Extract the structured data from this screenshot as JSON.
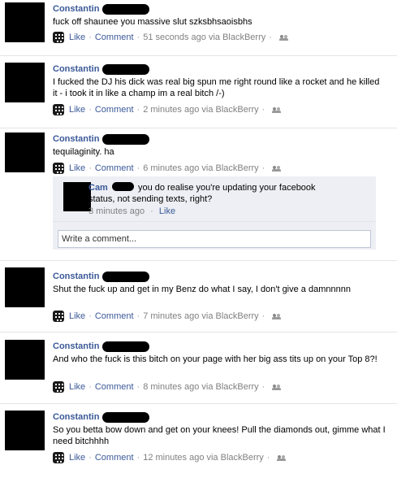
{
  "posts": [
    {
      "author": "Constantin",
      "message": "fuck off shaunee you massive slut szksbhsaoisbhs",
      "like": "Like",
      "comment": "Comment",
      "time": "51 seconds ago via BlackBerry"
    },
    {
      "author": "Constantin",
      "message": "I fucked the DJ his dick was real big spun me right round like a rocket and he killed it - i took it in like a champ im a real bitch /-)",
      "like": "Like",
      "comment": "Comment",
      "time": "2 minutes ago via BlackBerry"
    },
    {
      "author": "Constantin",
      "message": "tequilaginity. ha",
      "like": "Like",
      "comment": "Comment",
      "time": "6 minutes ago via BlackBerry",
      "comment_thread": {
        "author": "Cam",
        "text": "you do realise you're updating your facebook status, not sending texts, right?",
        "time": "3 minutes ago",
        "like": "Like",
        "input_placeholder": "Write a comment..."
      }
    },
    {
      "author": "Constantin",
      "message": "Shut the fuck up and get in my Benz do what I say, I don't give a damnnnnn",
      "like": "Like",
      "comment": "Comment",
      "time": "7 minutes ago via BlackBerry"
    },
    {
      "author": "Constantin",
      "message": "And who the fuck is this bitch on your page with her big ass tits up on your Top 8?!",
      "like": "Like",
      "comment": "Comment",
      "time": "8 minutes ago via BlackBerry"
    },
    {
      "author": "Constantin",
      "message": "So you betta bow down and get on your knees! Pull the diamonds out, gimme what I need bitchhhh",
      "like": "Like",
      "comment": "Comment",
      "time": "12 minutes ago via BlackBerry"
    }
  ],
  "separator": "·"
}
